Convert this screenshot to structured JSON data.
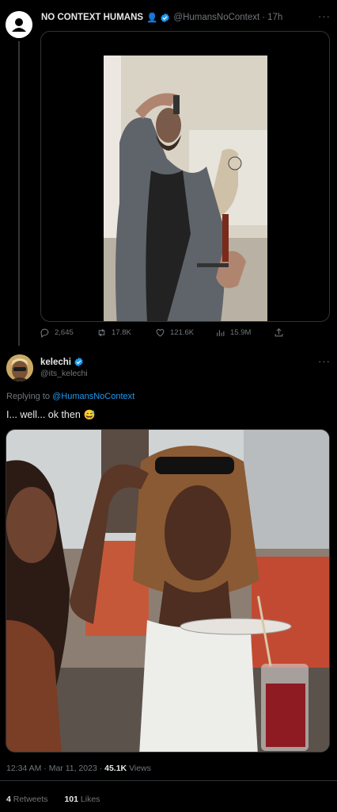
{
  "tweet": {
    "author_name": "NO CONTEXT HUMANS",
    "author_emoji": "👤",
    "handle": "@HumansNoContext",
    "separator": "·",
    "time": "17h",
    "more": "···",
    "media": {
      "kind": "video",
      "description_icon": "video-frame"
    },
    "actions": {
      "replies": "2,645",
      "retweets": "17.8K",
      "likes": "121.6K",
      "views": "15.9M"
    }
  },
  "reply": {
    "author_name": "kelechi",
    "handle": "@its_kelechi",
    "more": "···",
    "replying_prefix": "Replying to ",
    "replying_to": "@HumansNoContext",
    "text": "I... well... ok then",
    "emoji": "😅",
    "media": {
      "kind": "image"
    },
    "timestamp": "12:34 AM · Mar 11, 2023 · ",
    "views_count": "45.1K",
    "views_label": " Views",
    "retweets_count": "4",
    "retweets_label": " Retweets",
    "likes_count": "101",
    "likes_label": " Likes"
  },
  "colors": {
    "background": "#000000",
    "text": "#e7e9ea",
    "muted": "#71767b",
    "accent": "#1d9bf0",
    "border": "#2f3336"
  }
}
